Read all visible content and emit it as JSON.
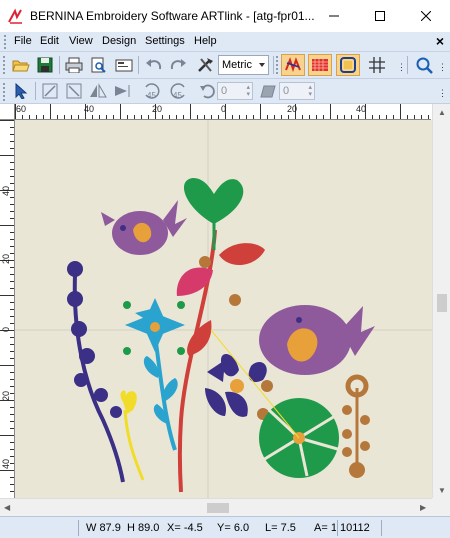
{
  "window": {
    "title": "BERNINA Embroidery Software ARTlink - [atg-fpr01...",
    "minimize_icon": "minimize-icon",
    "maximize_icon": "maximize-icon",
    "close_icon": "close-icon"
  },
  "menu": {
    "items": [
      "File",
      "Edit",
      "View",
      "Design",
      "Settings",
      "Help"
    ],
    "close_glyph": "×"
  },
  "toolbar1": {
    "unit_select": "Metric",
    "icons": [
      "open-folder-icon",
      "save-icon",
      "print-icon",
      "print-preview-icon",
      "export-card-icon",
      "undo-icon",
      "redo-icon",
      "hoop-tools-icon",
      "show-stitches-icon",
      "show-fills-icon",
      "show-hoop-icon",
      "grid-icon",
      "zoom-icon"
    ]
  },
  "toolbar2": {
    "spin1_value": "0",
    "spin2_value": "0",
    "icons": [
      "select-arrow-icon",
      "mirror-horizontal-icon",
      "mirror-vertical-icon",
      "flip-left-icon",
      "flip-right-icon",
      "rotate-45-left-icon",
      "rotate-45-right-icon",
      "rotate-icon",
      "skew-icon"
    ]
  },
  "ruler": {
    "top_labels": [
      "60",
      "40",
      "20",
      "0",
      "20",
      "40"
    ],
    "left_labels": [
      "40",
      "20",
      "0",
      "20",
      "40"
    ]
  },
  "status": {
    "w": "W  87.9",
    "h": "H  89.0",
    "x": "X=  -4.5",
    "y": "Y=   6.0",
    "l": "L=   7.5",
    "a": "A= 1",
    "stitches": "10112"
  },
  "colors": {
    "canvas": "#eae6d6",
    "toolbar": "#dfe8f5",
    "green": "#1f9a4a",
    "purple": "#8e5a9c",
    "navy": "#3b2f86",
    "teal": "#2aa4cf",
    "red": "#d0403a",
    "pink": "#d63a6a",
    "yellow": "#f2dc2a",
    "orange": "#d9892a",
    "brown": "#b5773a"
  }
}
